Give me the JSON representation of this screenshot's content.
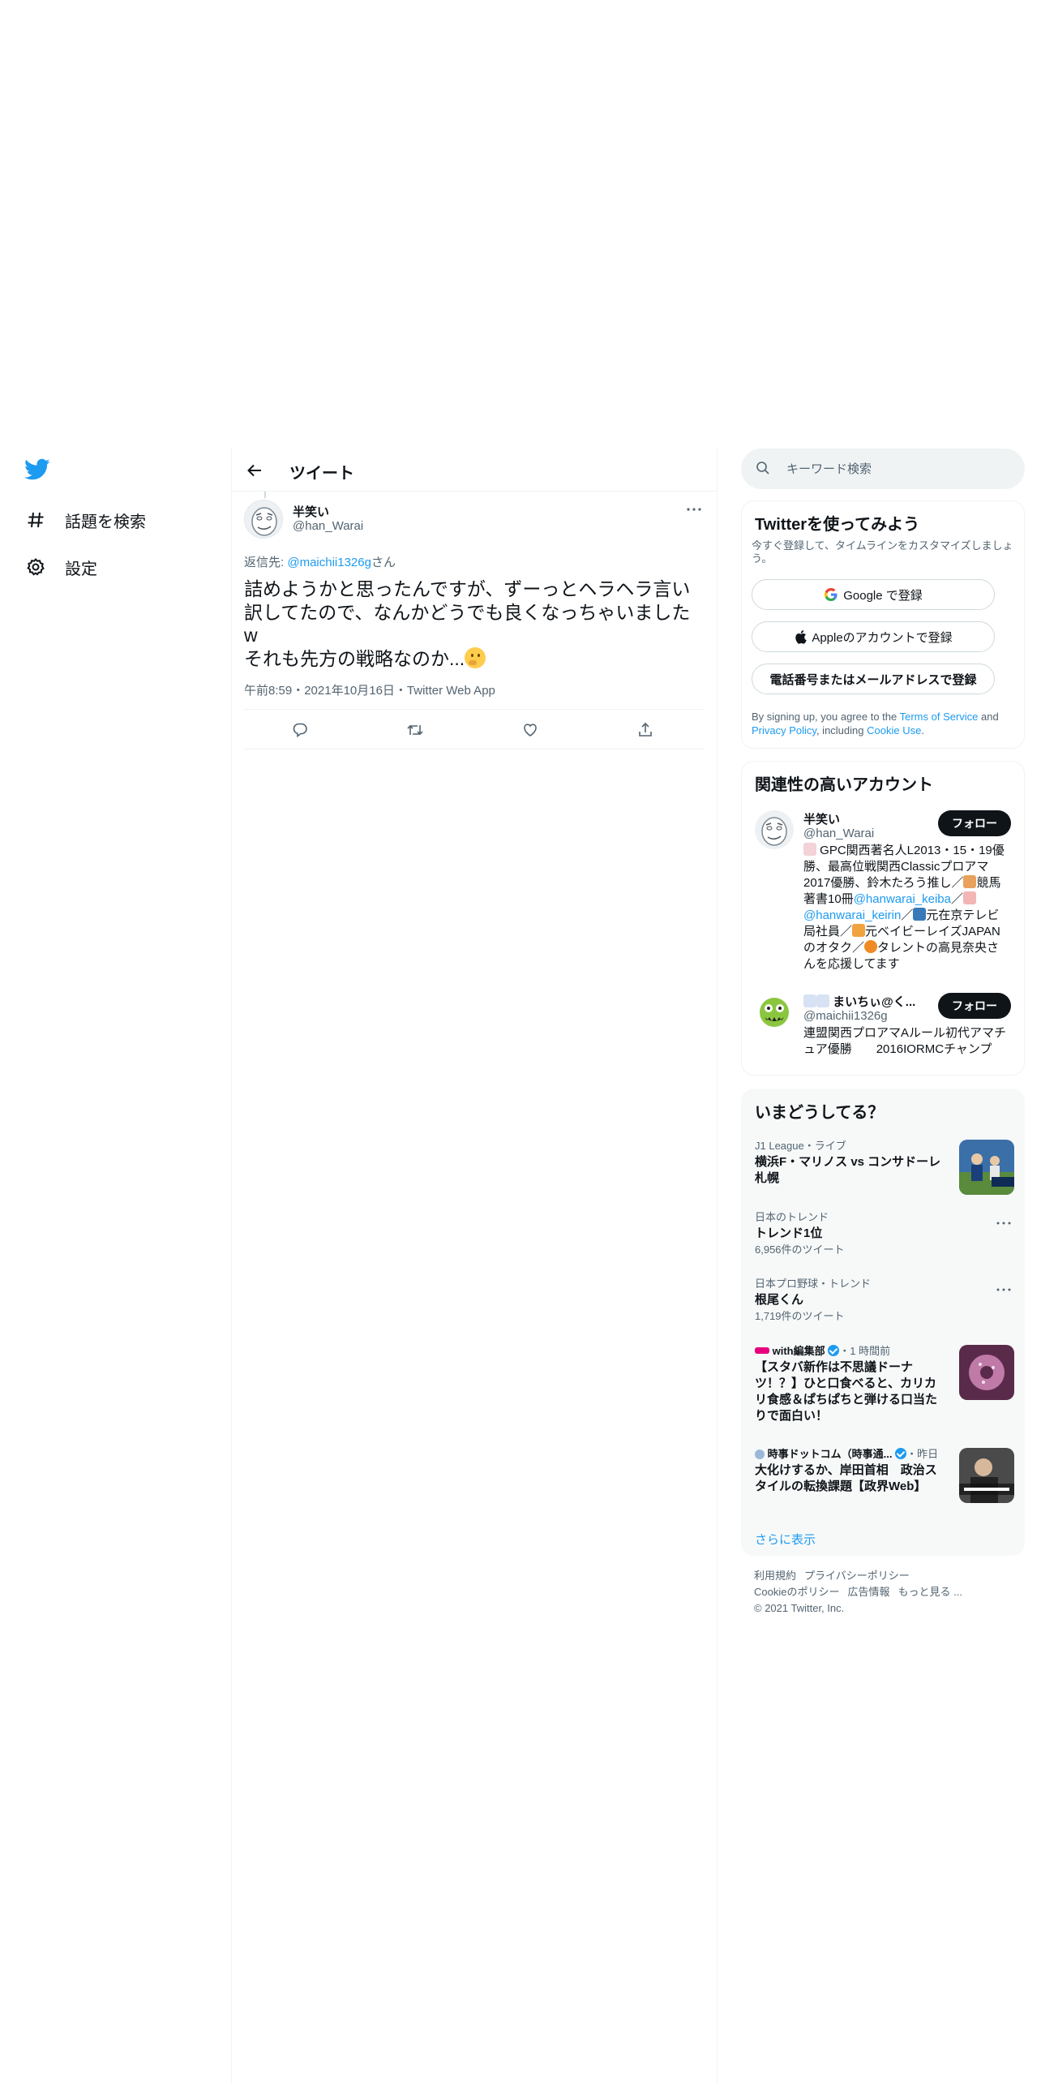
{
  "nav": {
    "logo": "twitter-bird-icon",
    "items": [
      {
        "label": "話題を検索",
        "icon": "hashtag-icon"
      },
      {
        "label": "設定",
        "icon": "gear-icon"
      }
    ],
    "brand_color": "#1d9bf0"
  },
  "header": {
    "title": "ツイート",
    "back_icon": "arrow-left-icon"
  },
  "tweet": {
    "author_name": "半笑い",
    "author_handle": "@han_Warai",
    "reply_prefix": "返信先: ",
    "reply_to": "@maichii1326g",
    "reply_suffix": "さん",
    "text": "詰めようかと思ったんですが、ずーっとヘラヘラ言い訳してたので、なんかどうでも良くなっちゃいましたw\nそれも先方の戦略なのか...",
    "emoji": "thinking-face-emoji",
    "meta": "午前8:59・2021年10月16日・Twitter Web App",
    "actions": [
      "reply-icon",
      "retweet-icon",
      "like-icon",
      "share-icon"
    ]
  },
  "search": {
    "placeholder": "キーワード検索"
  },
  "signup": {
    "title": "Twitterを使ってみよう",
    "subtitle": "今すぐ登録して、タイムラインをカスタマイズしましょう。",
    "google_label": "Google で登録",
    "apple_label": "Appleのアカウントで登録",
    "phone_label": "電話番号またはメールアドレスで登録",
    "legal_prefix": "By signing up, you agree to the ",
    "tos": "Terms of Service",
    "legal_and": " and ",
    "privacy": "Privacy Policy",
    "legal_including": ", including ",
    "cookie": "Cookie Use",
    "legal_end": "."
  },
  "related": {
    "title": "関連性の高いアカウント",
    "accounts": [
      {
        "name": "半笑い",
        "handle": "@han_Warai",
        "follow": "フォロー",
        "bio_1": "GPC関西著名人L2013・15・19優勝、最高位戦関西Classicプロアマ2017優勝、鈴木たろう推し／",
        "bio_2": "競馬著書10冊",
        "bio_link1": "@hanwarai_keiba",
        "bio_3": "／",
        "bio_link2": "@hanwarai_keirin",
        "bio_4": "／",
        "bio_5": "元在京テレビ局社員／",
        "bio_6": "元ベイビーレイズJAPANのオタク／",
        "bio_7": "タレントの高見奈央さんを応援してます"
      },
      {
        "name": "まいちぃ@く...",
        "handle": "@maichii1326g",
        "follow": "フォロー",
        "bio": "連盟関西プロアマAルール初代アマチュア優勝　　2016IORMCチャンプ"
      }
    ]
  },
  "trends": {
    "title": "いまどうしてる？",
    "items": [
      {
        "context": "J1 League・ライブ",
        "title": "横浜F・マリノス vs コンサドーレ札幌"
      },
      {
        "context": "日本のトレンド",
        "title": "トレンド1位",
        "count": "6,956件のツイート"
      },
      {
        "context": "日本プロ野球・トレンド",
        "title": "根尾くん",
        "count": "1,719件のツイート"
      },
      {
        "source": "with編集部",
        "time": "・1 時間前",
        "title": "【スタバ新作は不思議ドーナツ！？】ひと口食べると、カリカリ食感＆ぱちぱちと弾ける口当たりで面白い！"
      },
      {
        "source": "時事ドットコム（時事通...",
        "time": "・昨日",
        "title": "大化けするか、岸田首相　政治スタイルの転換課題【政界Web】"
      }
    ],
    "show_more": "さらに表示"
  },
  "footer": {
    "terms": "利用規約",
    "privacy": "プライバシーポリシー",
    "cookie": "Cookieのポリシー",
    "ads": "広告情報",
    "more": "もっと見る ...",
    "copyright": "© 2021 Twitter, Inc."
  }
}
